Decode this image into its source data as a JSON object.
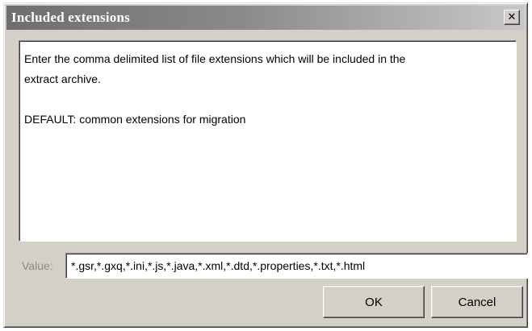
{
  "window": {
    "title": "Included extensions",
    "close_glyph": "✕"
  },
  "description": {
    "line1": "Enter the comma delimited list of file extensions which will be included in the",
    "line2": "extract archive.",
    "line3": "DEFAULT: common extensions for migration"
  },
  "value_field": {
    "label": "Value:",
    "value": "*.gsr,*.gxq,*.ini,*.js,*.java,*.xml,*.dtd,*.properties,*.txt,*.html"
  },
  "buttons": {
    "ok_label": "OK",
    "cancel_label": "Cancel"
  }
}
